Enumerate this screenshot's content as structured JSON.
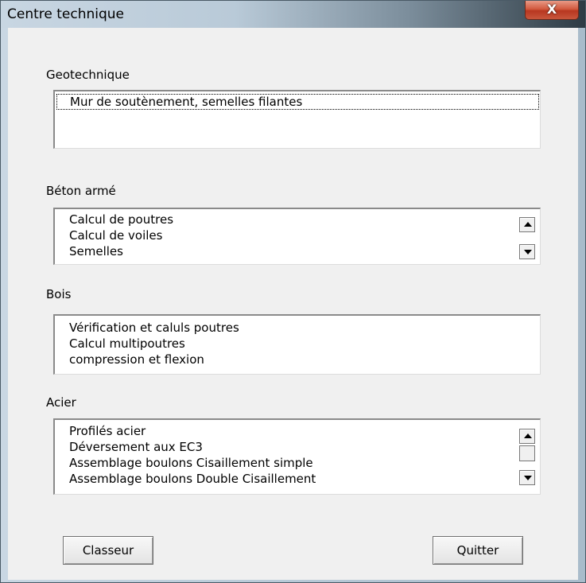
{
  "window": {
    "title": "Centre technique",
    "close_label": "X"
  },
  "sections": {
    "geotechnique": {
      "label": "Geotechnique",
      "items": [
        "Mur de soutènement, semelles filantes"
      ]
    },
    "beton": {
      "label": "Béton armé",
      "items": [
        "Calcul de poutres",
        "Calcul de voiles",
        "Semelles"
      ]
    },
    "bois": {
      "label": "Bois",
      "items": [
        "Vérification et caluls poutres",
        "Calcul multipoutres",
        "compression et flexion"
      ]
    },
    "acier": {
      "label": "Acier",
      "items": [
        "Profilés acier",
        "Déversement aux EC3",
        "Assemblage boulons Cisaillement simple",
        "Assemblage boulons Double Cisaillement"
      ]
    }
  },
  "buttons": {
    "classeur": "Classeur",
    "quitter": "Quitter"
  }
}
